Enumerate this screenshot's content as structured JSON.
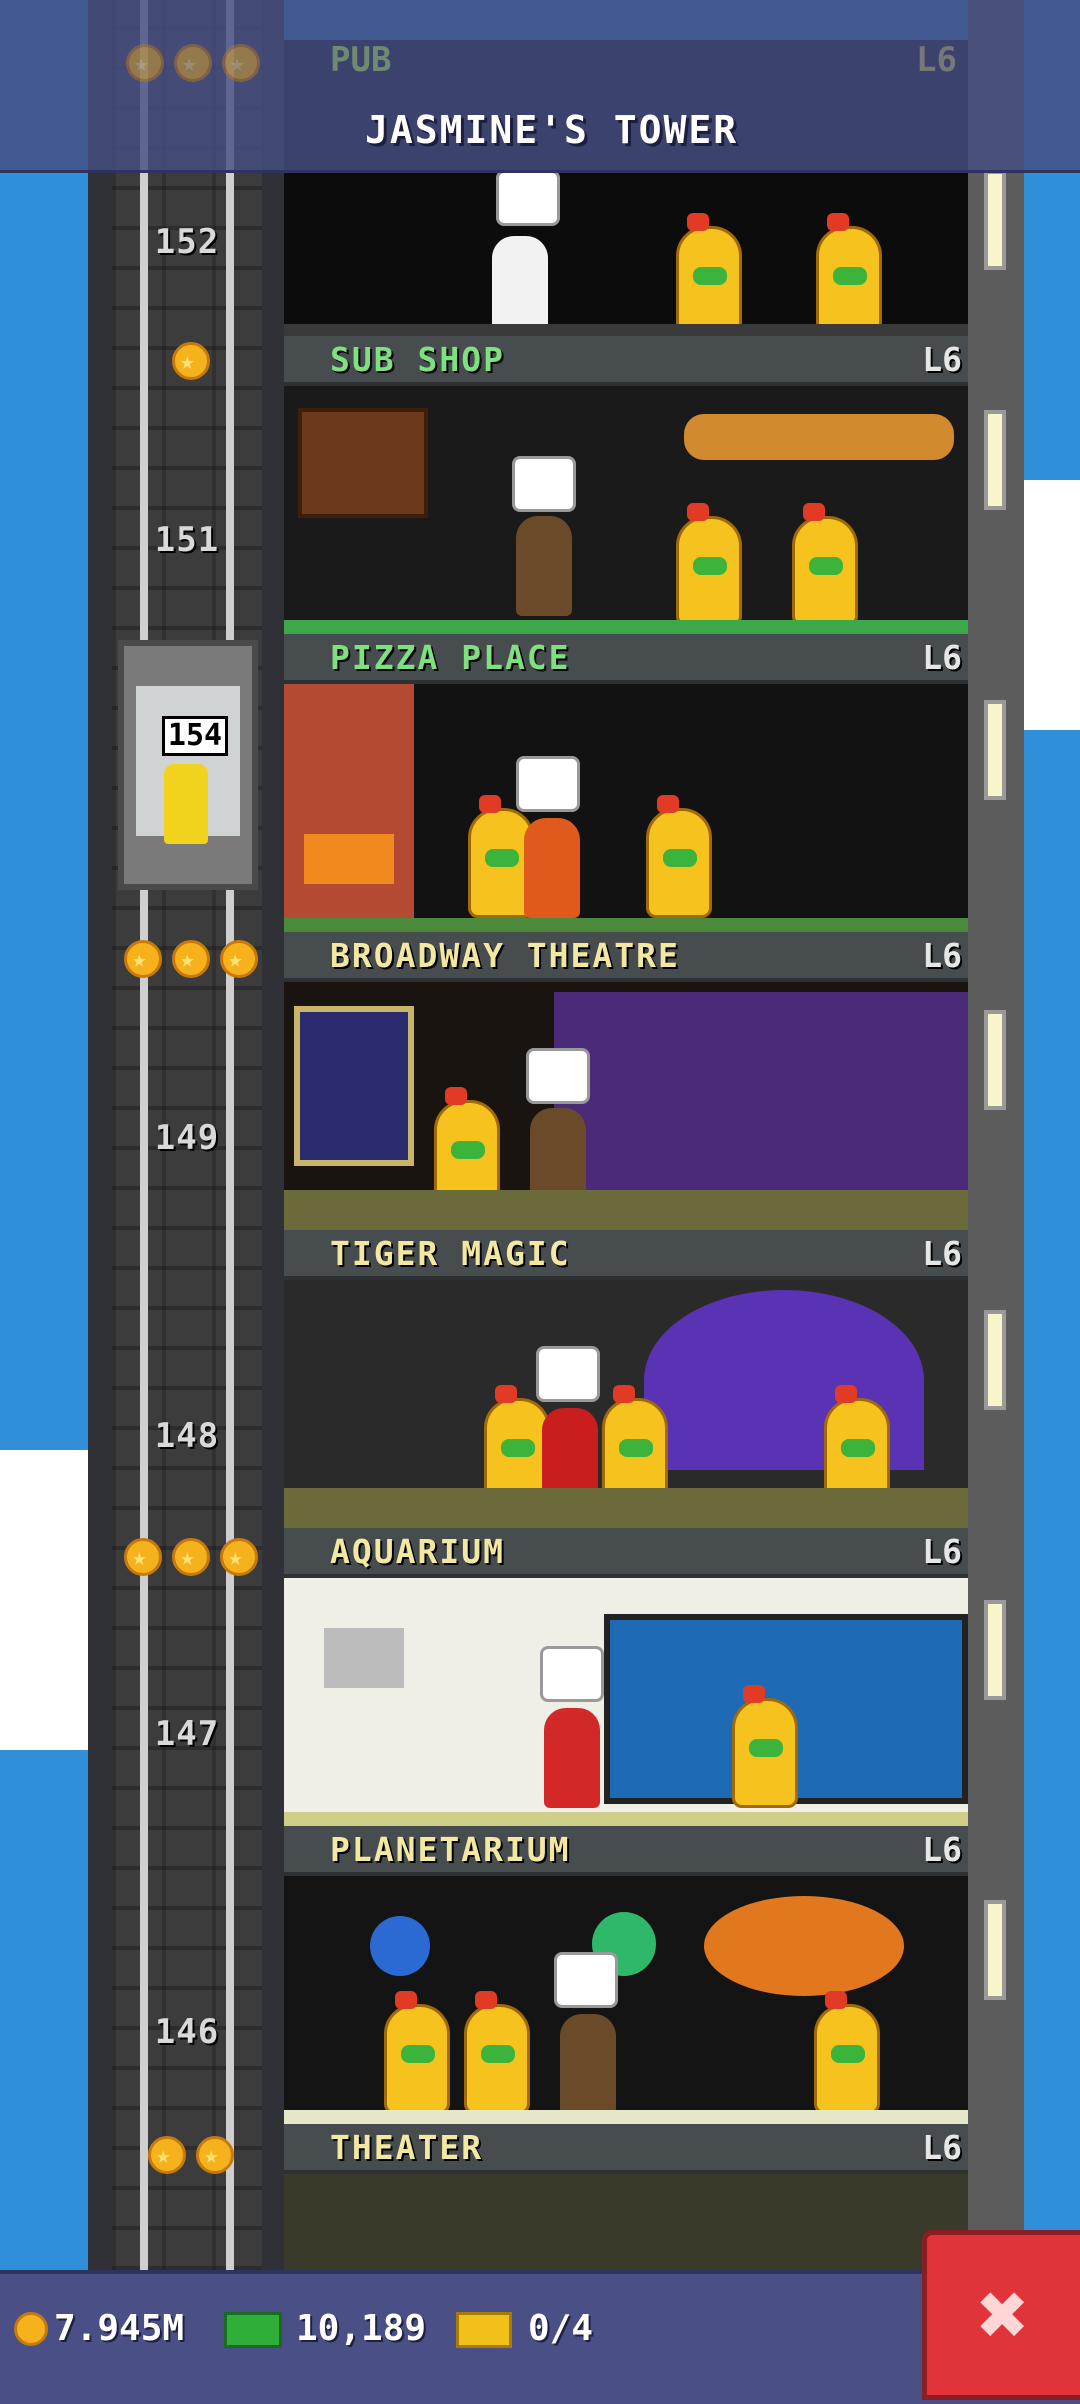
{
  "header": {
    "title": "JASMINE'S TOWER",
    "peek_floor_name": "PUB",
    "peek_floor_level": "L6"
  },
  "elevator": {
    "floor_display": "154"
  },
  "floor_numbers": [
    "152",
    "151",
    "149",
    "148",
    "147",
    "146"
  ],
  "floors": [
    {
      "name": "SUB SHOP",
      "level": "L6",
      "name_color": "#7fe07f"
    },
    {
      "name": "PIZZA PLACE",
      "level": "L6",
      "name_color": "#7fe07f"
    },
    {
      "name": "BROADWAY THEATRE",
      "level": "L6",
      "name_color": "#f2e8a0"
    },
    {
      "name": "TIGER MAGIC",
      "level": "L6",
      "name_color": "#f2e8a0"
    },
    {
      "name": "AQUARIUM",
      "level": "L6",
      "name_color": "#f2e8a0"
    },
    {
      "name": "PLANETARIUM",
      "level": "L6",
      "name_color": "#f2e8a0"
    },
    {
      "name": "THEATER",
      "level": "L6",
      "name_color": "#f2e8a0"
    }
  ],
  "status_bar": {
    "coins": "7.945M",
    "bux": "10,189",
    "tickets": "0/4"
  },
  "icons": {
    "coin": "coin-icon",
    "bux": "tower-bux-icon",
    "ticket": "golden-ticket-icon",
    "close": "close-icon"
  },
  "colors": {
    "sky": "#2f8fd8",
    "header": "#464e82",
    "close_button": "#e0343a"
  }
}
